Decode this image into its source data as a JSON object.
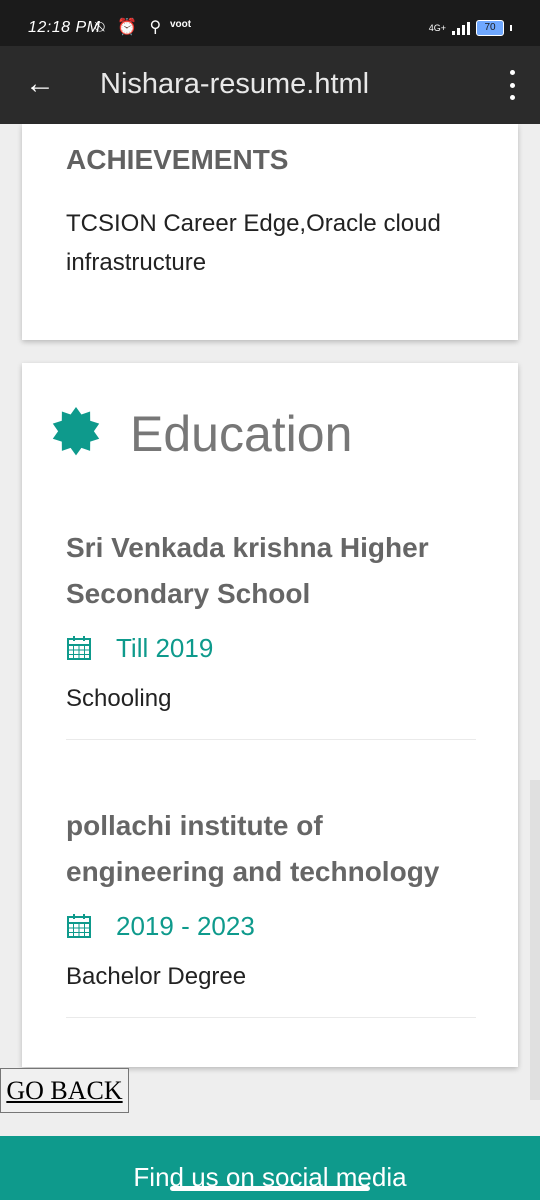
{
  "status_bar": {
    "time": "12:18 PM",
    "icons": [
      "muted-notification-icon",
      "alarm-icon",
      "running-icon"
    ],
    "net_label": "voot",
    "network": "4G+",
    "battery": "70"
  },
  "appbar": {
    "back_icon": "←",
    "title": "Nishara-resume.html"
  },
  "achievements": {
    "heading": "ACHIEVEMENTS",
    "text": "TCSION Career Edge,Oracle cloud infrastructure"
  },
  "education": {
    "title": "Education",
    "entries": [
      {
        "name": "Sri Venkada krishna Higher Secondary School",
        "date": "Till 2019",
        "desc": "Schooling"
      },
      {
        "name": "pollachi institute of engineering and technology",
        "date": "2019 - 2023",
        "desc": "Bachelor Degree"
      }
    ]
  },
  "go_back_label": "GO BACK",
  "footer_text": "Find us on social media",
  "colors": {
    "accent": "#0e9a8c",
    "appbar": "#2b2b2b"
  }
}
